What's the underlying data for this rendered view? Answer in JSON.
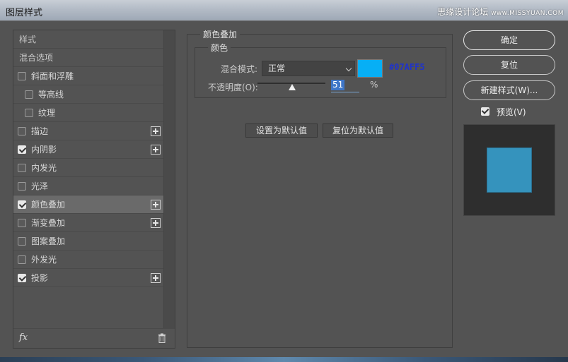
{
  "window": {
    "title": "图层样式",
    "watermark": "思缘设计论坛",
    "watermark_url": "www.MISSYUAN.COM"
  },
  "style_list": {
    "items": [
      {
        "label": "样式",
        "type": "header"
      },
      {
        "label": "混合选项",
        "type": "header"
      },
      {
        "label": "斜面和浮雕",
        "checked": false,
        "indent": false,
        "has_add": false,
        "selected": false
      },
      {
        "label": "等高线",
        "checked": false,
        "indent": true,
        "has_add": false,
        "selected": false
      },
      {
        "label": "纹理",
        "checked": false,
        "indent": true,
        "has_add": false,
        "selected": false
      },
      {
        "label": "描边",
        "checked": false,
        "indent": false,
        "has_add": true,
        "selected": false
      },
      {
        "label": "内阴影",
        "checked": true,
        "indent": false,
        "has_add": true,
        "selected": false
      },
      {
        "label": "内发光",
        "checked": false,
        "indent": false,
        "has_add": false,
        "selected": false
      },
      {
        "label": "光泽",
        "checked": false,
        "indent": false,
        "has_add": false,
        "selected": false
      },
      {
        "label": "颜色叠加",
        "checked": true,
        "indent": false,
        "has_add": true,
        "selected": true
      },
      {
        "label": "渐变叠加",
        "checked": false,
        "indent": false,
        "has_add": true,
        "selected": false
      },
      {
        "label": "图案叠加",
        "checked": false,
        "indent": false,
        "has_add": false,
        "selected": false
      },
      {
        "label": "外发光",
        "checked": false,
        "indent": false,
        "has_add": false,
        "selected": false
      },
      {
        "label": "投影",
        "checked": true,
        "indent": false,
        "has_add": true,
        "selected": false
      }
    ],
    "footer": {
      "fx_label": "fx"
    }
  },
  "color_overlay": {
    "section_title": "颜色叠加",
    "group_title": "颜色",
    "blend_mode_label": "混合模式:",
    "blend_mode_value": "正常",
    "color_hex": "#07AFF5",
    "color_value": "#07AFF5",
    "hex_text_color": "#1f33cc",
    "opacity_label": "不透明度(O):",
    "opacity_value": "51",
    "opacity_unit": "%",
    "opacity_fraction": 0.51,
    "set_default_label": "设置为默认值",
    "reset_default_label": "复位为默认值"
  },
  "actions": {
    "ok_label": "确定",
    "reset_label": "复位",
    "new_style_label": "新建样式(W)...",
    "preview_label": "预览(V)",
    "preview_checked": true
  },
  "preview": {
    "swatch_color": "#3593bd"
  }
}
